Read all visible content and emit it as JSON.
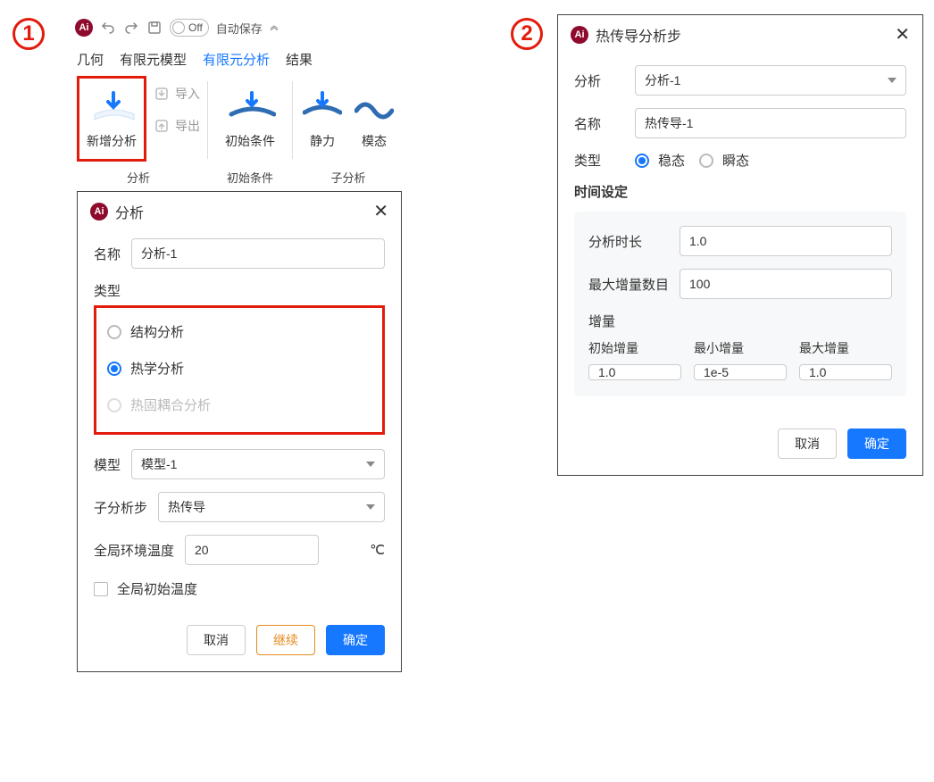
{
  "badges": {
    "one": "1",
    "two": "2"
  },
  "topbar": {
    "toggle_label": "Off",
    "autosave": "自动保存"
  },
  "tabs": {
    "geometry": "几何",
    "fe_model": "有限元模型",
    "fe_analysis": "有限元分析",
    "results": "结果"
  },
  "ribbon": {
    "new_analysis": "新增分析",
    "import": "导入",
    "export": "导出",
    "initial_cond": "初始条件",
    "static": "静力",
    "modal": "模态",
    "group_analysis": "分析",
    "group_initial": "初始条件",
    "group_sub": "子分析"
  },
  "dialog1": {
    "title": "分析",
    "name_label": "名称",
    "name_value": "分析-1",
    "type_label": "类型",
    "opt_struct": "结构分析",
    "opt_thermal": "热学分析",
    "opt_coupled": "热固耦合分析",
    "model_label": "模型",
    "model_value": "模型-1",
    "substep_label": "子分析步",
    "substep_value": "热传导",
    "env_temp_label": "全局环境温度",
    "env_temp_value": "20",
    "env_temp_unit": "℃",
    "init_temp_label": "全局初始温度",
    "cancel": "取消",
    "continue": "继续",
    "ok": "确定"
  },
  "dialog2": {
    "title": "热传导分析步",
    "analysis_label": "分析",
    "analysis_value": "分析-1",
    "name_label": "名称",
    "name_value": "热传导-1",
    "type_label": "类型",
    "opt_steady": "稳态",
    "opt_transient": "瞬态",
    "timing_title": "时间设定",
    "duration_label": "分析时长",
    "duration_value": "1.0",
    "max_inc_count_label": "最大增量数目",
    "max_inc_count_value": "100",
    "increment_label": "增量",
    "init_inc_label": "初始增量",
    "min_inc_label": "最小增量",
    "max_inc_label": "最大增量",
    "init_inc_value": "1.0",
    "min_inc_value": "1e-5",
    "max_inc_value": "1.0",
    "cancel": "取消",
    "ok": "确定"
  }
}
